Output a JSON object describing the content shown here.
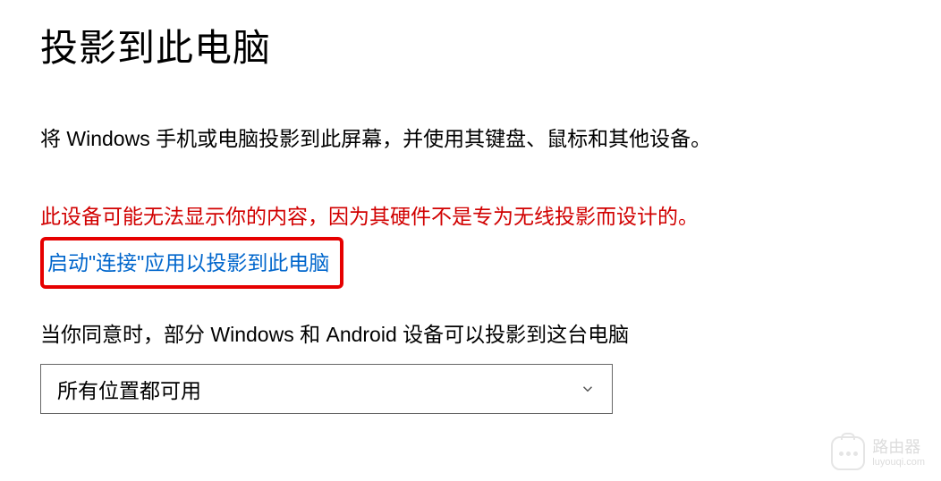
{
  "page": {
    "title": "投影到此电脑",
    "description": "将 Windows 手机或电脑投影到此屏幕，并使用其键盘、鼠标和其他设备。",
    "warning": "此设备可能无法显示你的内容，因为其硬件不是专为无线投影而设计的。",
    "launch_link": "启动\"连接\"应用以投影到此电脑",
    "dropdown_label": "当你同意时，部分 Windows 和 Android 设备可以投影到这台电脑",
    "dropdown_value": "所有位置都可用"
  },
  "watermark": {
    "label": "路由器",
    "url": "luyouqi.com"
  }
}
